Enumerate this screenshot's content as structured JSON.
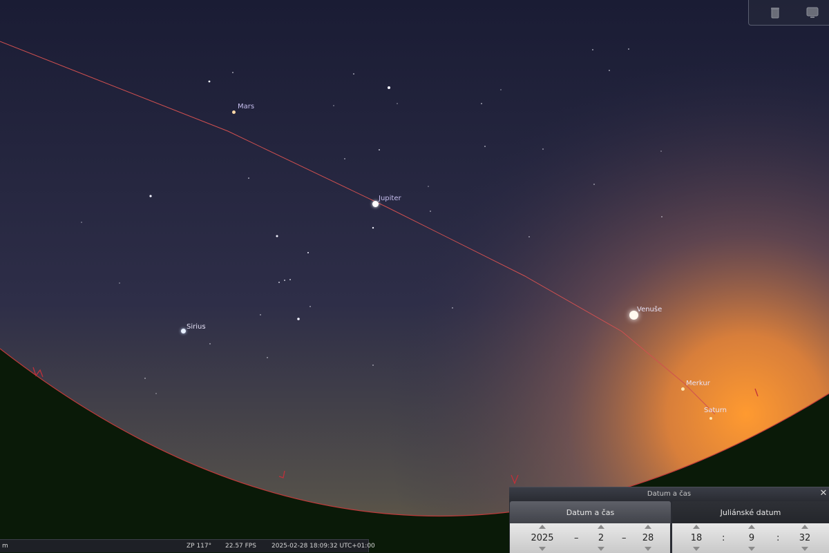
{
  "sky": {
    "planets": [
      {
        "name": "Mars",
        "key": "mars"
      },
      {
        "name": "Jupiter",
        "key": "jupiter"
      },
      {
        "name": "Venuše",
        "key": "venus"
      },
      {
        "name": "Sirius",
        "key": "sirius"
      },
      {
        "name": "Merkur",
        "key": "mercury"
      },
      {
        "name": "Saturn",
        "key": "saturn"
      }
    ],
    "cardinals": {
      "north": "S",
      "east": "V",
      "south": "J",
      "west": "Z"
    },
    "line_color": "#d04040",
    "ground_color": "#0a1a08"
  },
  "top_panel": {
    "icons": [
      "trash-icon",
      "monitor-icon"
    ]
  },
  "status": {
    "left": "m",
    "fov": "ZP 117°",
    "fps": "22.57 FPS",
    "datetime": "2025-02-28 18:09:32 UTC+01:00"
  },
  "dialog": {
    "title": "Datum a čas",
    "close": "✕",
    "tabs": [
      "Datum a čas",
      "Juliánské datum"
    ],
    "date": {
      "year": "2025",
      "sep1": "–",
      "month": "2",
      "sep2": "–",
      "day": "28"
    },
    "time": {
      "hour": "18",
      "sep1": ":",
      "minute": "9",
      "sep2": ":",
      "second": "32"
    }
  }
}
